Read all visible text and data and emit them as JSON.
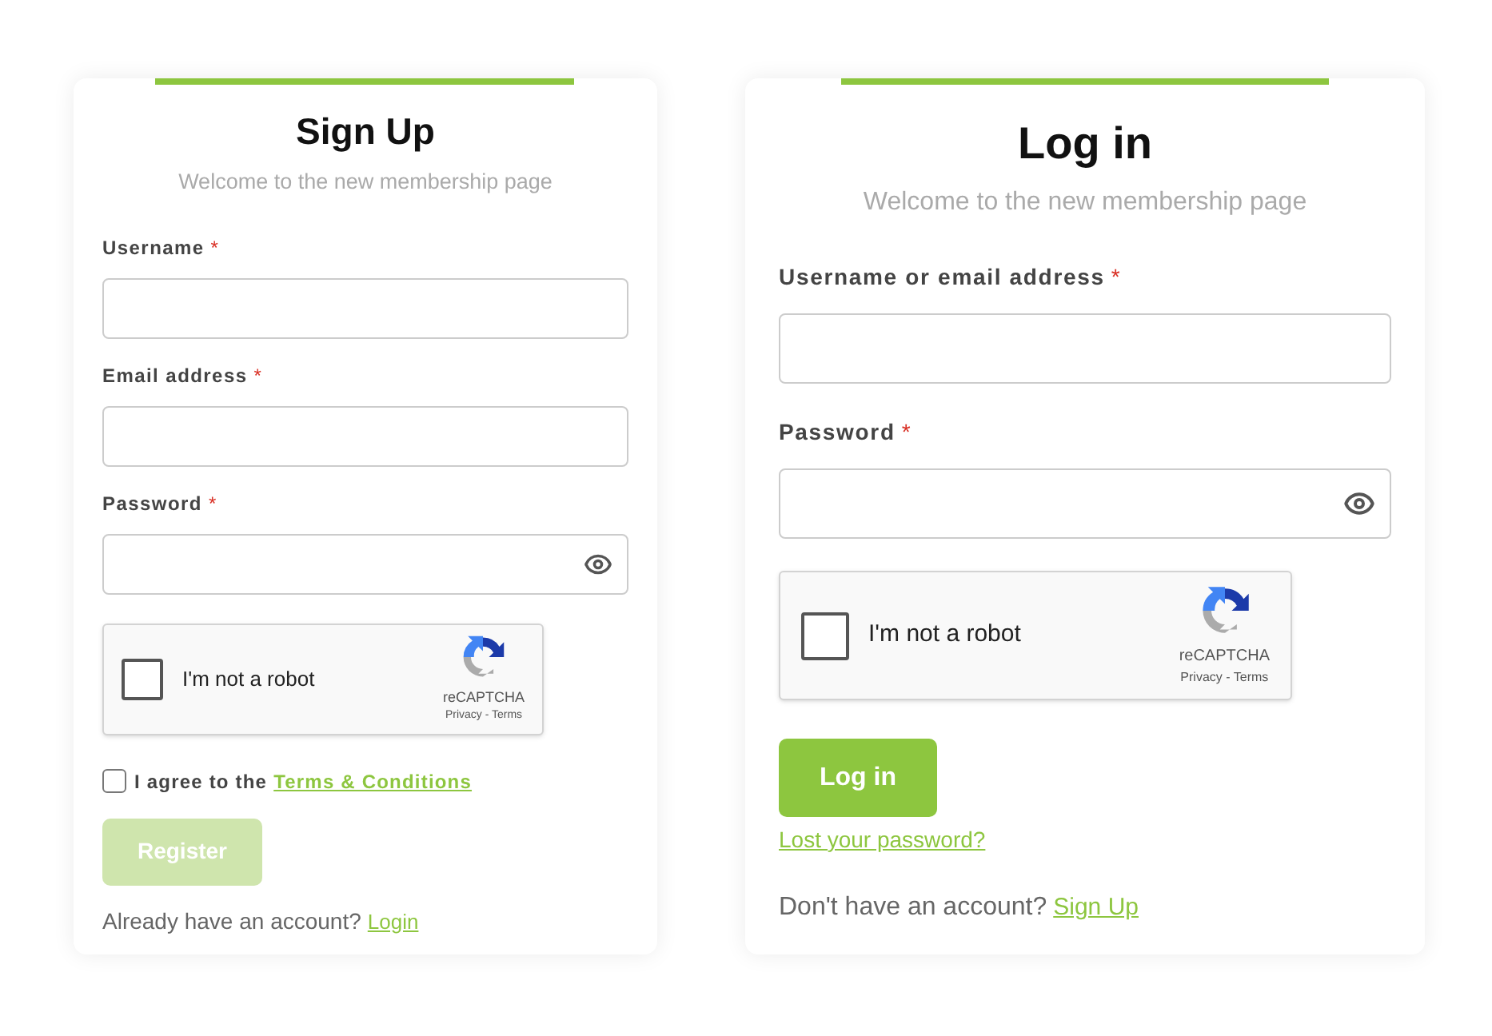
{
  "signup": {
    "title": "Sign Up",
    "subtitle": "Welcome to the new membership page",
    "fields": [
      {
        "label": "Username",
        "required_mark": "*",
        "kind": "text"
      },
      {
        "label": "Email address",
        "required_mark": "*",
        "kind": "text"
      },
      {
        "label": "Password",
        "required_mark": "*",
        "kind": "password"
      }
    ],
    "captcha": {
      "label": "I'm not a robot",
      "brand": "reCAPTCHA",
      "links": "Privacy - Terms",
      "checked": false
    },
    "agree": {
      "text": "I agree to the",
      "link": "Terms & Conditions",
      "checked": false
    },
    "button": {
      "label": "Register",
      "disabled": true
    },
    "footer": {
      "text": "Already have an account?",
      "link": "Login"
    }
  },
  "login": {
    "title": "Log in",
    "subtitle": "Welcome to the new membership page",
    "fields": [
      {
        "label": "Username or email address",
        "required_mark": "*",
        "kind": "text"
      },
      {
        "label": "Password",
        "required_mark": "*",
        "kind": "password"
      }
    ],
    "captcha": {
      "label": "I'm not a robot",
      "brand": "reCAPTCHA",
      "links": "Privacy - Terms",
      "checked": false
    },
    "button": {
      "label": "Log in",
      "disabled": false
    },
    "lost_password": "Lost your password?",
    "footer": {
      "text": "Don't have an account?",
      "link": "Sign Up"
    }
  }
}
